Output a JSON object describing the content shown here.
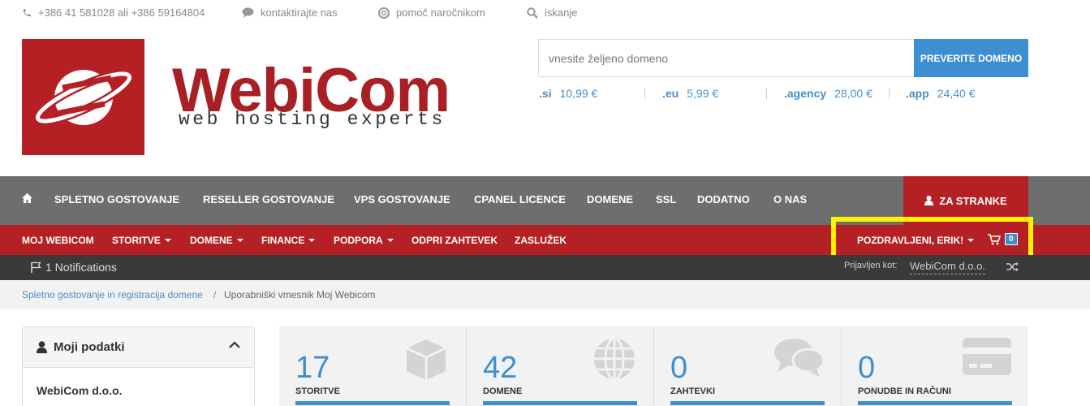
{
  "topbar": {
    "phone": "+386 41 581028 ali +386 59164804",
    "contact": "kontaktirajte nas",
    "help": "pomoč naročnikom",
    "search": "iskanje"
  },
  "logo": {
    "name": "WebiCom",
    "tagline": "web hosting experts"
  },
  "domain_search": {
    "placeholder": "vnesite željeno domeno",
    "button": "PREVERITE DOMENO",
    "prices": [
      {
        "ext": ".si",
        "price": "10,99 €"
      },
      {
        "ext": ".eu",
        "price": "5,99 €"
      },
      {
        "ext": ".agency",
        "price": "28,00 €"
      },
      {
        "ext": ".app",
        "price": "24,40 €"
      }
    ]
  },
  "mainnav": {
    "items": [
      "SPLETNO GOSTOVANJE",
      "RESELLER GOSTOVANJE",
      "VPS GOSTOVANJE",
      "CPANEL LICENCE",
      "DOMENE",
      "SSL",
      "DODATNO",
      "O NAS"
    ],
    "clients": "ZA STRANKE"
  },
  "clientnav": {
    "items": [
      "MOJ WEBICOM",
      "STORITVE",
      "DOMENE",
      "FINANCE",
      "PODPORA",
      "ODPRI ZAHTEVEK",
      "ZASLUŽEK"
    ],
    "greeting": "POZDRAVLJENI, ERIK!",
    "cart_count": "0"
  },
  "notifbar": {
    "notifications": "1 Notifications",
    "logged_as_label": "Prijavljen kot:",
    "logged_as_value": "WebiCom d.o.o."
  },
  "breadcrumb": {
    "home": "Spletno gostovanje in registracija domene",
    "separator": "/",
    "current": "Uporabniški vmesnik Moj Webicom"
  },
  "panel": {
    "title": "Moji podatki",
    "company": "WebiCom d.o.o."
  },
  "stats": [
    {
      "value": "17",
      "label": "STORITVE",
      "icon": "cube-icon"
    },
    {
      "value": "42",
      "label": "DOMENE",
      "icon": "globe-icon"
    },
    {
      "value": "0",
      "label": "ZAHTEVKI",
      "icon": "comments-icon"
    },
    {
      "value": "0",
      "label": "PONUDBE IN RAČUNI",
      "icon": "credit-card-icon"
    }
  ],
  "colors": {
    "brand_red": "#b52025",
    "accent_blue": "#3e8fd1",
    "nav_gray": "#6e6e6e",
    "highlight": "#fff200"
  }
}
